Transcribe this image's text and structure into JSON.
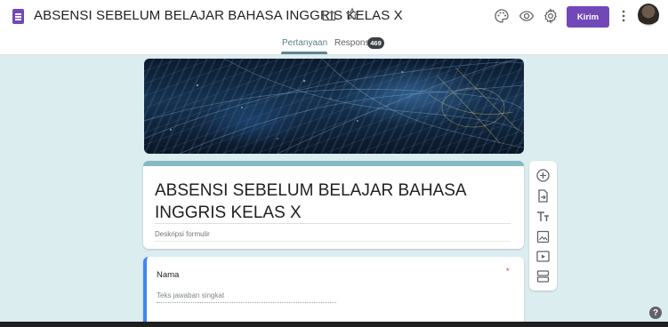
{
  "header": {
    "title": "ABSENSI SEBELUM BELAJAR BAHASA INGGRIS KELAS X",
    "send_label": "Kirim",
    "icons": [
      "forms-icon",
      "folder-icon",
      "star-icon",
      "palette-icon",
      "eye-icon",
      "settings-icon",
      "more-icon",
      "avatar"
    ]
  },
  "tabs": [
    {
      "label": "Pertanyaan",
      "active": true
    },
    {
      "label": "Respons",
      "badge": "469"
    }
  ],
  "form": {
    "title": "ABSENSI SEBELUM BELAJAR BAHASA INGGRIS KELAS X",
    "description_placeholder": "Deskripsi formulir"
  },
  "questions": [
    {
      "label": "Nama",
      "required_mark": "*",
      "answer_placeholder": "Teks jawaban singkat"
    }
  ],
  "toolbar": {
    "tools": [
      "add-question-icon",
      "import-questions-icon",
      "add-title-icon",
      "add-image-icon",
      "add-video-icon",
      "add-section-icon"
    ]
  },
  "colors": {
    "accent": "#7248b9",
    "background": "#dcedf0",
    "title_card_top": "#86b8c3",
    "active_question": "#4285f4"
  }
}
